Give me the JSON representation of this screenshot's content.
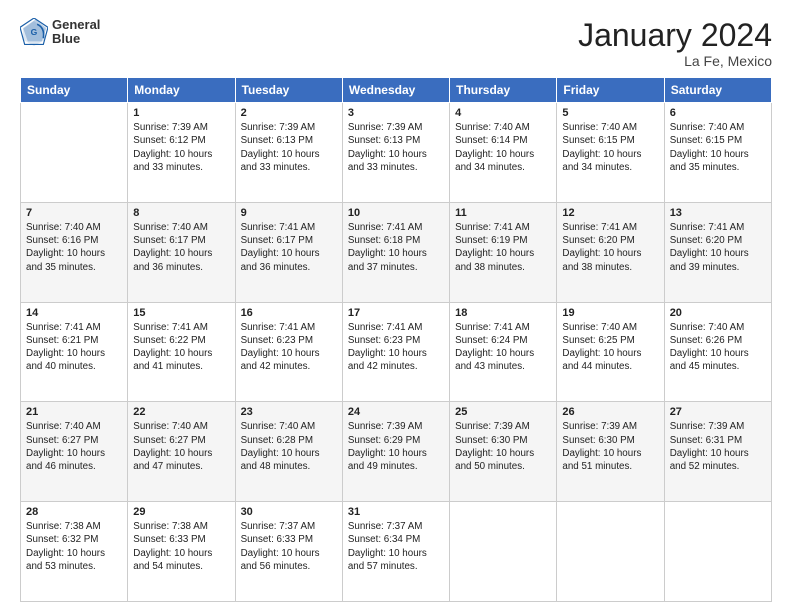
{
  "header": {
    "logo_line1": "General",
    "logo_line2": "Blue",
    "title": "January 2024",
    "subtitle": "La Fe, Mexico"
  },
  "columns": [
    "Sunday",
    "Monday",
    "Tuesday",
    "Wednesday",
    "Thursday",
    "Friday",
    "Saturday"
  ],
  "weeks": [
    [
      {
        "day": "",
        "info": ""
      },
      {
        "day": "1",
        "info": "Sunrise: 7:39 AM\nSunset: 6:12 PM\nDaylight: 10 hours\nand 33 minutes."
      },
      {
        "day": "2",
        "info": "Sunrise: 7:39 AM\nSunset: 6:13 PM\nDaylight: 10 hours\nand 33 minutes."
      },
      {
        "day": "3",
        "info": "Sunrise: 7:39 AM\nSunset: 6:13 PM\nDaylight: 10 hours\nand 33 minutes."
      },
      {
        "day": "4",
        "info": "Sunrise: 7:40 AM\nSunset: 6:14 PM\nDaylight: 10 hours\nand 34 minutes."
      },
      {
        "day": "5",
        "info": "Sunrise: 7:40 AM\nSunset: 6:15 PM\nDaylight: 10 hours\nand 34 minutes."
      },
      {
        "day": "6",
        "info": "Sunrise: 7:40 AM\nSunset: 6:15 PM\nDaylight: 10 hours\nand 35 minutes."
      }
    ],
    [
      {
        "day": "7",
        "info": "Sunrise: 7:40 AM\nSunset: 6:16 PM\nDaylight: 10 hours\nand 35 minutes."
      },
      {
        "day": "8",
        "info": "Sunrise: 7:40 AM\nSunset: 6:17 PM\nDaylight: 10 hours\nand 36 minutes."
      },
      {
        "day": "9",
        "info": "Sunrise: 7:41 AM\nSunset: 6:17 PM\nDaylight: 10 hours\nand 36 minutes."
      },
      {
        "day": "10",
        "info": "Sunrise: 7:41 AM\nSunset: 6:18 PM\nDaylight: 10 hours\nand 37 minutes."
      },
      {
        "day": "11",
        "info": "Sunrise: 7:41 AM\nSunset: 6:19 PM\nDaylight: 10 hours\nand 38 minutes."
      },
      {
        "day": "12",
        "info": "Sunrise: 7:41 AM\nSunset: 6:20 PM\nDaylight: 10 hours\nand 38 minutes."
      },
      {
        "day": "13",
        "info": "Sunrise: 7:41 AM\nSunset: 6:20 PM\nDaylight: 10 hours\nand 39 minutes."
      }
    ],
    [
      {
        "day": "14",
        "info": "Sunrise: 7:41 AM\nSunset: 6:21 PM\nDaylight: 10 hours\nand 40 minutes."
      },
      {
        "day": "15",
        "info": "Sunrise: 7:41 AM\nSunset: 6:22 PM\nDaylight: 10 hours\nand 41 minutes."
      },
      {
        "day": "16",
        "info": "Sunrise: 7:41 AM\nSunset: 6:23 PM\nDaylight: 10 hours\nand 42 minutes."
      },
      {
        "day": "17",
        "info": "Sunrise: 7:41 AM\nSunset: 6:23 PM\nDaylight: 10 hours\nand 42 minutes."
      },
      {
        "day": "18",
        "info": "Sunrise: 7:41 AM\nSunset: 6:24 PM\nDaylight: 10 hours\nand 43 minutes."
      },
      {
        "day": "19",
        "info": "Sunrise: 7:40 AM\nSunset: 6:25 PM\nDaylight: 10 hours\nand 44 minutes."
      },
      {
        "day": "20",
        "info": "Sunrise: 7:40 AM\nSunset: 6:26 PM\nDaylight: 10 hours\nand 45 minutes."
      }
    ],
    [
      {
        "day": "21",
        "info": "Sunrise: 7:40 AM\nSunset: 6:27 PM\nDaylight: 10 hours\nand 46 minutes."
      },
      {
        "day": "22",
        "info": "Sunrise: 7:40 AM\nSunset: 6:27 PM\nDaylight: 10 hours\nand 47 minutes."
      },
      {
        "day": "23",
        "info": "Sunrise: 7:40 AM\nSunset: 6:28 PM\nDaylight: 10 hours\nand 48 minutes."
      },
      {
        "day": "24",
        "info": "Sunrise: 7:39 AM\nSunset: 6:29 PM\nDaylight: 10 hours\nand 49 minutes."
      },
      {
        "day": "25",
        "info": "Sunrise: 7:39 AM\nSunset: 6:30 PM\nDaylight: 10 hours\nand 50 minutes."
      },
      {
        "day": "26",
        "info": "Sunrise: 7:39 AM\nSunset: 6:30 PM\nDaylight: 10 hours\nand 51 minutes."
      },
      {
        "day": "27",
        "info": "Sunrise: 7:39 AM\nSunset: 6:31 PM\nDaylight: 10 hours\nand 52 minutes."
      }
    ],
    [
      {
        "day": "28",
        "info": "Sunrise: 7:38 AM\nSunset: 6:32 PM\nDaylight: 10 hours\nand 53 minutes."
      },
      {
        "day": "29",
        "info": "Sunrise: 7:38 AM\nSunset: 6:33 PM\nDaylight: 10 hours\nand 54 minutes."
      },
      {
        "day": "30",
        "info": "Sunrise: 7:37 AM\nSunset: 6:33 PM\nDaylight: 10 hours\nand 56 minutes."
      },
      {
        "day": "31",
        "info": "Sunrise: 7:37 AM\nSunset: 6:34 PM\nDaylight: 10 hours\nand 57 minutes."
      },
      {
        "day": "",
        "info": ""
      },
      {
        "day": "",
        "info": ""
      },
      {
        "day": "",
        "info": ""
      }
    ]
  ]
}
